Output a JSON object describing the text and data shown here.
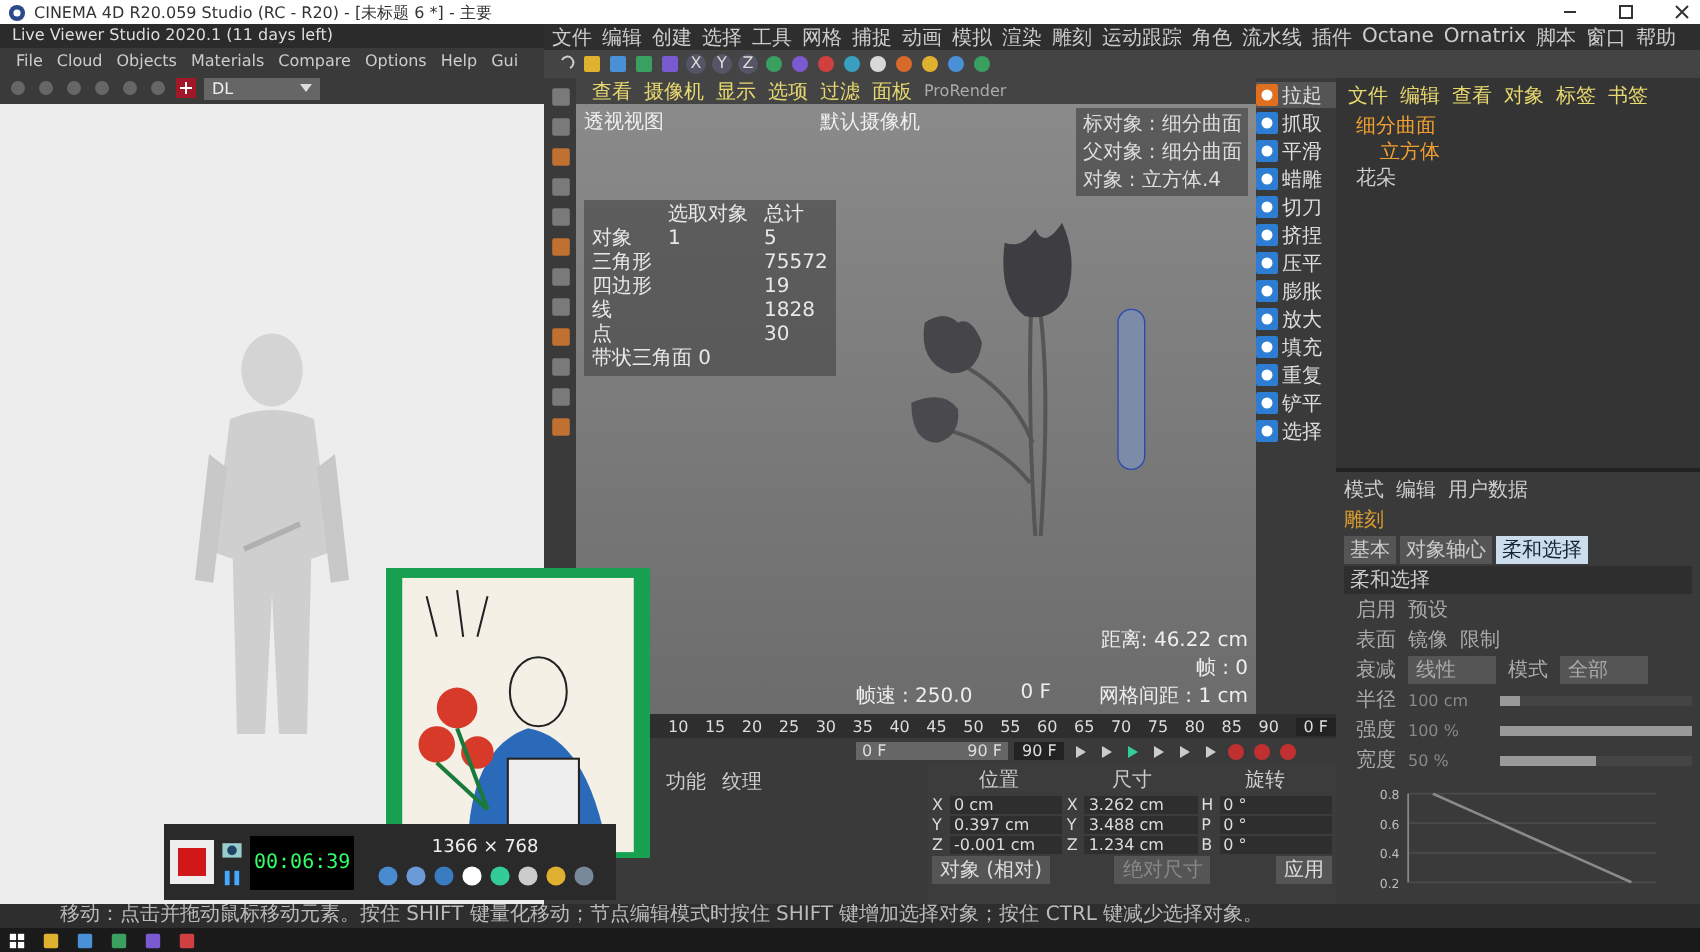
{
  "title_bar": {
    "title": "CINEMA 4D R20.059 Studio (RC - R20) - [未标题 6 *] - 主要"
  },
  "live_viewer": {
    "title": "Live Viewer Studio 2020.1 (11 days left)",
    "menu": [
      "File",
      "Cloud",
      "Objects",
      "Materials",
      "Compare",
      "Options",
      "Help",
      "Gui"
    ],
    "renderer": "DL"
  },
  "recorder": {
    "timer": "00:06:39",
    "resolution": "1366 × 768"
  },
  "menu": [
    "文件",
    "编辑",
    "创建",
    "选择",
    "工具",
    "网格",
    "捕捉",
    "动画",
    "模拟",
    "渲染",
    "雕刻",
    "运动跟踪",
    "角色",
    "流水线",
    "插件",
    "Octane",
    "Ornatrix",
    "脚本",
    "窗口",
    "帮助"
  ],
  "toolbar": {
    "axes": [
      "X",
      "Y",
      "Z"
    ]
  },
  "viewport": {
    "tabs": [
      "查看",
      "摄像机",
      "显示",
      "选项",
      "过滤",
      "面板",
      "ProRender"
    ],
    "view_name": "透视视图",
    "camera": "默认摄像机",
    "stats": {
      "header": [
        "选取对象",
        "总计"
      ],
      "rows": [
        {
          "label": "对象",
          "selected": "1",
          "total": "5"
        },
        {
          "label": "三角形",
          "total": "75572"
        },
        {
          "label": "四边形",
          "total": "19"
        },
        {
          "label": "线",
          "total": "1828"
        },
        {
          "label": "点",
          "total": "30"
        }
      ],
      "footer": "带状三角面 0"
    },
    "info": [
      "标对象 : 细分曲面",
      "父对象 : 细分曲面",
      "对象 : 立方体.4"
    ],
    "distance": "距离: 46.22 cm",
    "frame_count": "帧 : 0",
    "frame_rate": "帧速 : 250.0",
    "frame": "0 F",
    "grid": "网格间距 : 1 cm"
  },
  "sculpt_tools": [
    {
      "label": "拉起",
      "selected": true
    },
    {
      "label": "抓取",
      "selected": false
    },
    {
      "label": "平滑",
      "selected": false
    },
    {
      "label": "蜡雕",
      "selected": false
    },
    {
      "label": "切刀",
      "selected": false
    },
    {
      "label": "挤捏",
      "selected": false
    },
    {
      "label": "压平",
      "selected": false
    },
    {
      "label": "膨胀",
      "selected": false
    },
    {
      "label": "放大",
      "selected": false
    },
    {
      "label": "填充",
      "selected": false
    },
    {
      "label": "重复",
      "selected": false
    },
    {
      "label": "铲平",
      "selected": false
    },
    {
      "label": "选择",
      "selected": false
    }
  ],
  "object_manager": {
    "tabs": [
      "文件",
      "编辑",
      "查看",
      "对象",
      "标签",
      "书签"
    ],
    "objects": [
      {
        "name": "细分曲面",
        "selected": true,
        "children": [
          {
            "name": "立方体",
            "selected": true
          }
        ]
      },
      {
        "name": "花朵",
        "selected": false
      }
    ]
  },
  "attributes": {
    "menu": [
      "模式",
      "编辑",
      "用户数据"
    ],
    "title": "雕刻",
    "tabs": [
      {
        "label": "基本",
        "selected": false
      },
      {
        "label": "对象轴心",
        "selected": false
      },
      {
        "label": "柔和选择",
        "selected": true
      }
    ],
    "section": "柔和选择",
    "options": [
      [
        "启用",
        "预设"
      ],
      [
        "表面",
        "镜像",
        "限制"
      ]
    ],
    "falloff": {
      "label": "衰减",
      "value": "线性"
    },
    "mode": {
      "label": "模式",
      "value": "全部"
    },
    "sliders": [
      {
        "label": "半径",
        "reading": "100 cm",
        "level": 0.1
      },
      {
        "label": "强度",
        "reading": "100 %",
        "level": 1
      },
      {
        "label": "宽度",
        "reading": "50 %",
        "level": 0.5
      }
    ],
    "chart_data": {
      "type": "line",
      "series": [
        {
          "color": "#8a8a8a",
          "values": [
            0.8,
            0.65,
            0.5,
            0.35,
            0.2
          ]
        }
      ],
      "ylim": [
        0.2,
        0.8
      ],
      "yticks": [
        0.2,
        0.4,
        0.6,
        0.8
      ],
      "grid": true
    }
  },
  "timeline": {
    "range": {
      "level": 1
    },
    "ticks": [
      "10",
      "15",
      "20",
      "25",
      "30",
      "35",
      "40",
      "45",
      "50",
      "55",
      "60",
      "65",
      "70",
      "75",
      "80",
      "85",
      "90"
    ],
    "current": "0 F",
    "start": "0 F",
    "range_end": "90 F",
    "end": "90 F"
  },
  "material_manager": {
    "menu": [
      "功能",
      "纹理"
    ]
  },
  "coordinates": {
    "headers": [
      "位置",
      "尺寸",
      "旋转"
    ],
    "rows": [
      [
        "X",
        "0 cm",
        "X",
        "3.262 cm",
        "H",
        "0 °"
      ],
      [
        "Y",
        "0.397 cm",
        "Y",
        "3.488 cm",
        "P",
        "0 °"
      ],
      [
        "Z",
        "-0.001 cm",
        "Z",
        "1.234 cm",
        "B",
        "0 °"
      ]
    ],
    "mode": "对象 (相对)",
    "size_mode": "绝对尺寸",
    "apply": "应用"
  },
  "status_bar": "移动：点击并拖动鼠标移动元素。按住 SHIFT 键量化移动；节点编辑模式时按住 SHIFT 键增加选择对象；按住 CTRL 键减少选择对象。"
}
